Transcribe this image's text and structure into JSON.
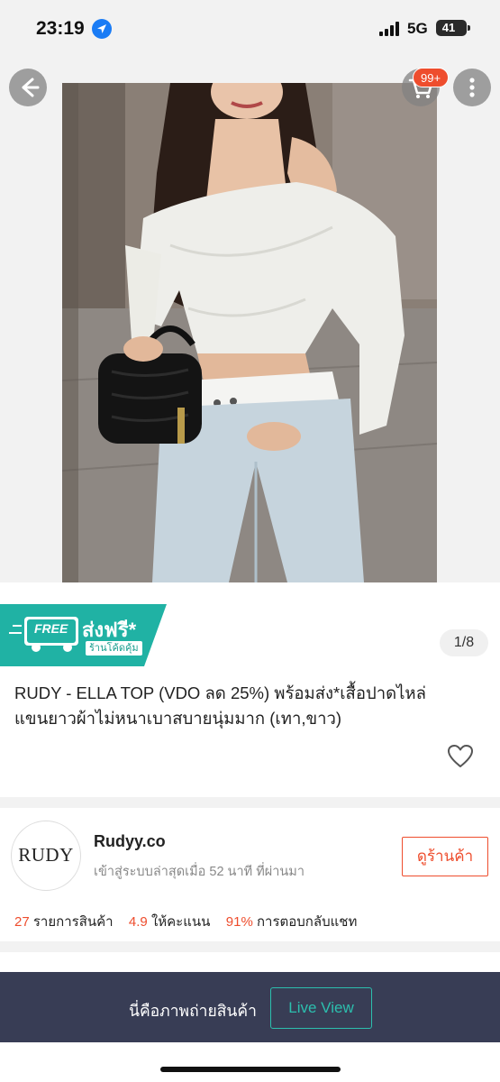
{
  "status_bar": {
    "time": "23:19",
    "network": "5G",
    "battery": "41",
    "icons": [
      "location-arrow-icon",
      "signal-bars-icon",
      "battery-icon"
    ]
  },
  "header": {
    "cart_badge": "99+",
    "icons": [
      "back-arrow-icon",
      "cart-icon",
      "more-vertical-icon"
    ]
  },
  "gallery": {
    "page_counter": "1/8"
  },
  "promo_banner": {
    "free_label": "FREE",
    "shipping_label": "ส่งฟรี*",
    "shop_note": "ร้านโค้ดคุ้ม",
    "color": "#20b2a4"
  },
  "product": {
    "title_line1": "RUDY - ELLA TOP (VDO ลด 25%) พร้อมส่ง*เสื้อปาดไหล่",
    "title_line2": "แขนยาวผ้าไม่หนาเบาสบายนุ่มมาก (เทา,ขาว)"
  },
  "shop": {
    "logo_text": "RUDY",
    "name": "Rudyy.co",
    "status": "เข้าสู่ระบบล่าสุดเมื่อ 52 นาที ที่ผ่านมา",
    "view_button": "ดูร้านค้า",
    "stats": [
      {
        "value": "27",
        "label": "รายการสินค้า"
      },
      {
        "value": "4.9",
        "label": "ให้คะแนน"
      },
      {
        "value": "91%",
        "label": "การตอบกลับแชท"
      }
    ],
    "accent_color": "#ee4d2d"
  },
  "live_bar": {
    "label": "นี่คือภาพถ่ายสินค้า",
    "button": "Live View",
    "accent_color": "#2cbfae"
  }
}
